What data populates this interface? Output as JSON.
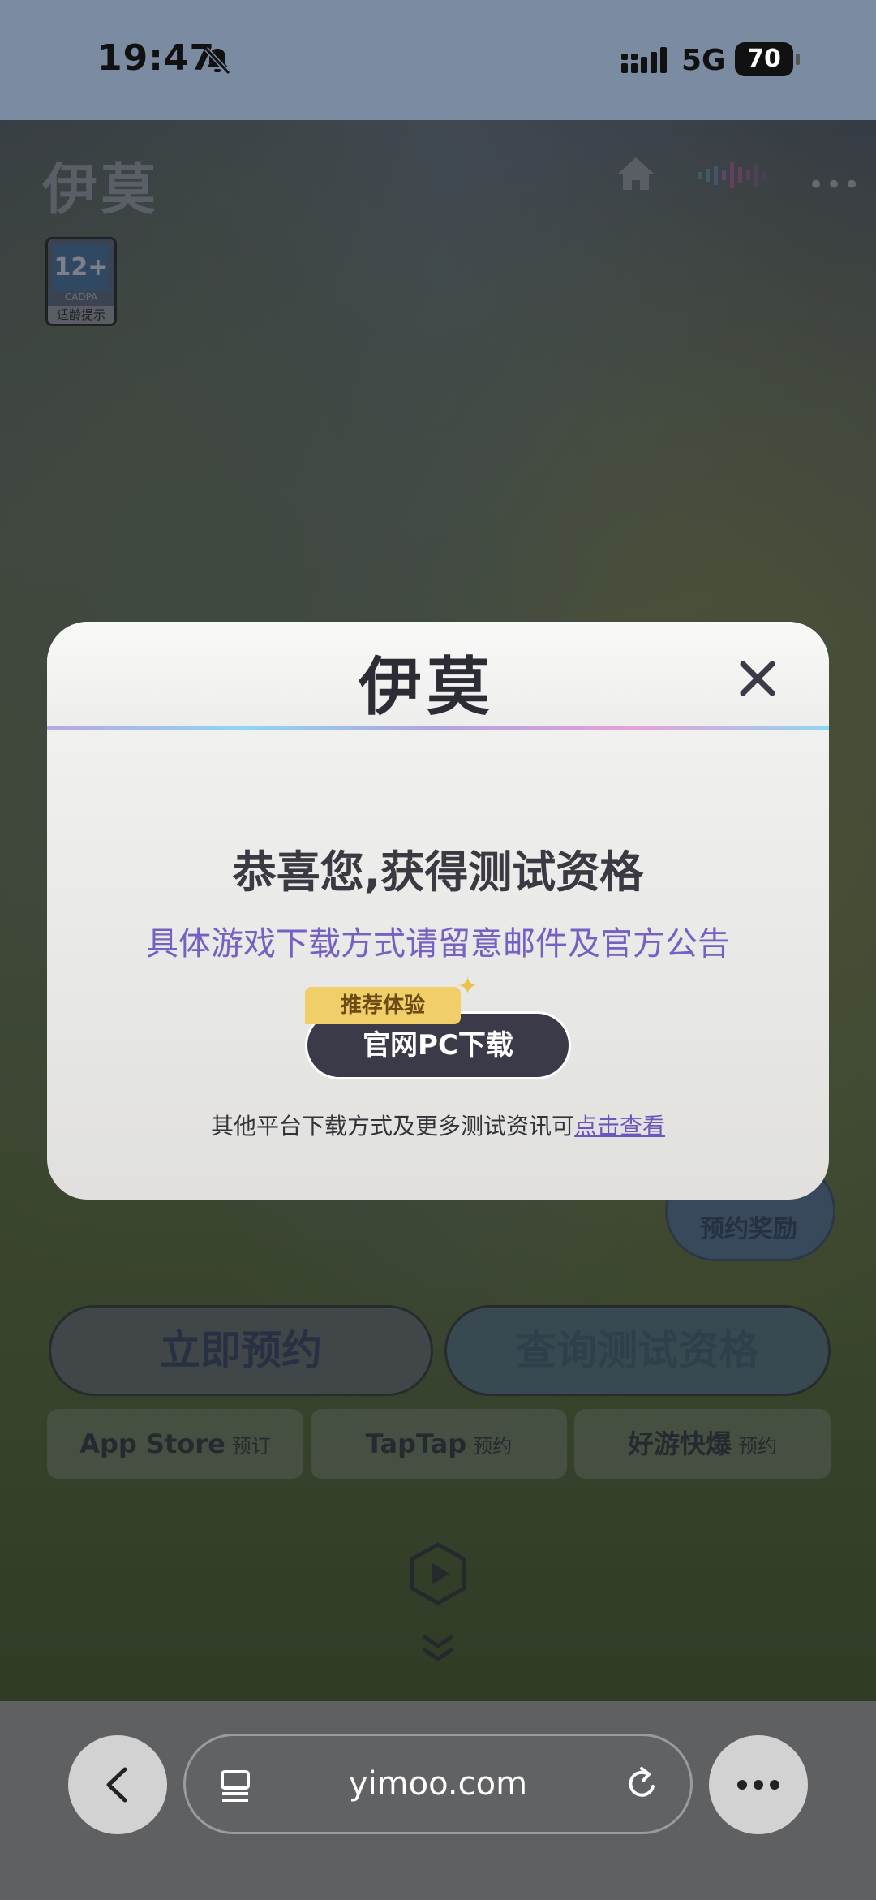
{
  "status_bar": {
    "time": "19:47",
    "network": "5G",
    "battery": "70"
  },
  "page": {
    "logo": "伊莫",
    "age_rating": {
      "age": "12+",
      "org": "CADPA",
      "tip": "适龄提示"
    },
    "promo_badge": "预约奖励",
    "cta_reserve": "立即预约",
    "cta_query": "查询测试资格",
    "stores": [
      {
        "name": "App Store",
        "action": "预订"
      },
      {
        "name": "TapTap",
        "action": "预约"
      },
      {
        "name": "好游快爆",
        "action": "预约"
      }
    ]
  },
  "modal": {
    "logo": "伊莫",
    "title": "恭喜您,获得测试资格",
    "subtitle": "具体游戏下载方式请留意邮件及官方公告",
    "tag": "推荐体验",
    "button": "官网PC下载",
    "footer_text": "其他平台下载方式及更多测试资讯可",
    "footer_link": "点击查看"
  },
  "browser": {
    "url": "yimoo.com"
  },
  "colors": {
    "accent_purple": "#7560c4",
    "tag_yellow": "#f1cf68",
    "button_dark": "#3b3a48"
  }
}
